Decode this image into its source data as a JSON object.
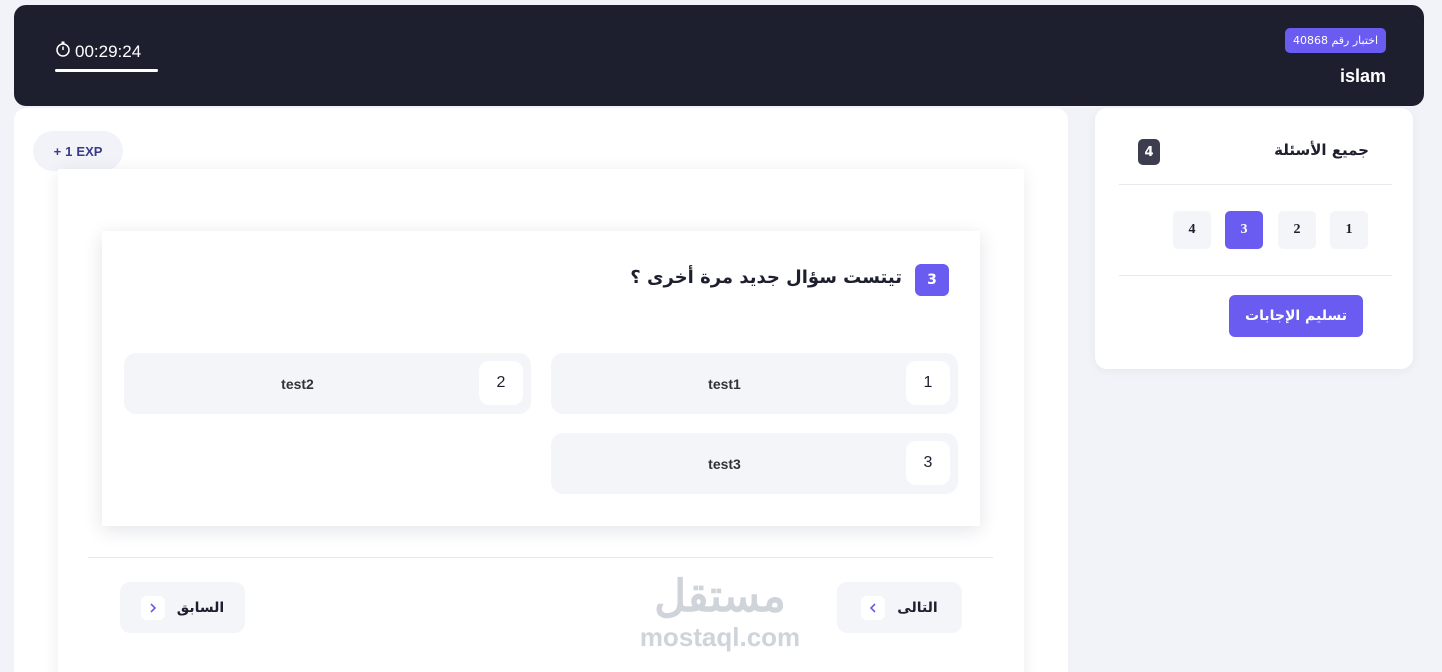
{
  "header": {
    "exam_badge": "اختبار رقم 40868",
    "user_name": "islam",
    "timer": "00:29:24",
    "timer_icon": "stopwatch-icon"
  },
  "exp_badge": {
    "plus": "+",
    "value": "1",
    "label": "EXP"
  },
  "question": {
    "number": "3",
    "text": "تيتست سؤال جديد مرة أخرى ؟",
    "options": [
      {
        "num": "1",
        "text": "test1"
      },
      {
        "num": "2",
        "text": "test2"
      },
      {
        "num": "3",
        "text": "test3"
      }
    ]
  },
  "navigation": {
    "next_label": "التالى",
    "prev_label": "السابق",
    "next_icon": "chevron-left-icon",
    "prev_icon": "chevron-right-icon"
  },
  "watermark": {
    "arabic": "مستقل",
    "latin": "mostaql.com"
  },
  "sidebar": {
    "title": "جميع الأسئلة",
    "count": "4",
    "questions": [
      "1",
      "2",
      "3",
      "4"
    ],
    "active_question": "3",
    "submit_label": "تسليم الإجابات"
  },
  "colors": {
    "accent": "#6a5cf0",
    "header_bg": "#1e1f2e",
    "page_bg": "#f1f3f8"
  }
}
